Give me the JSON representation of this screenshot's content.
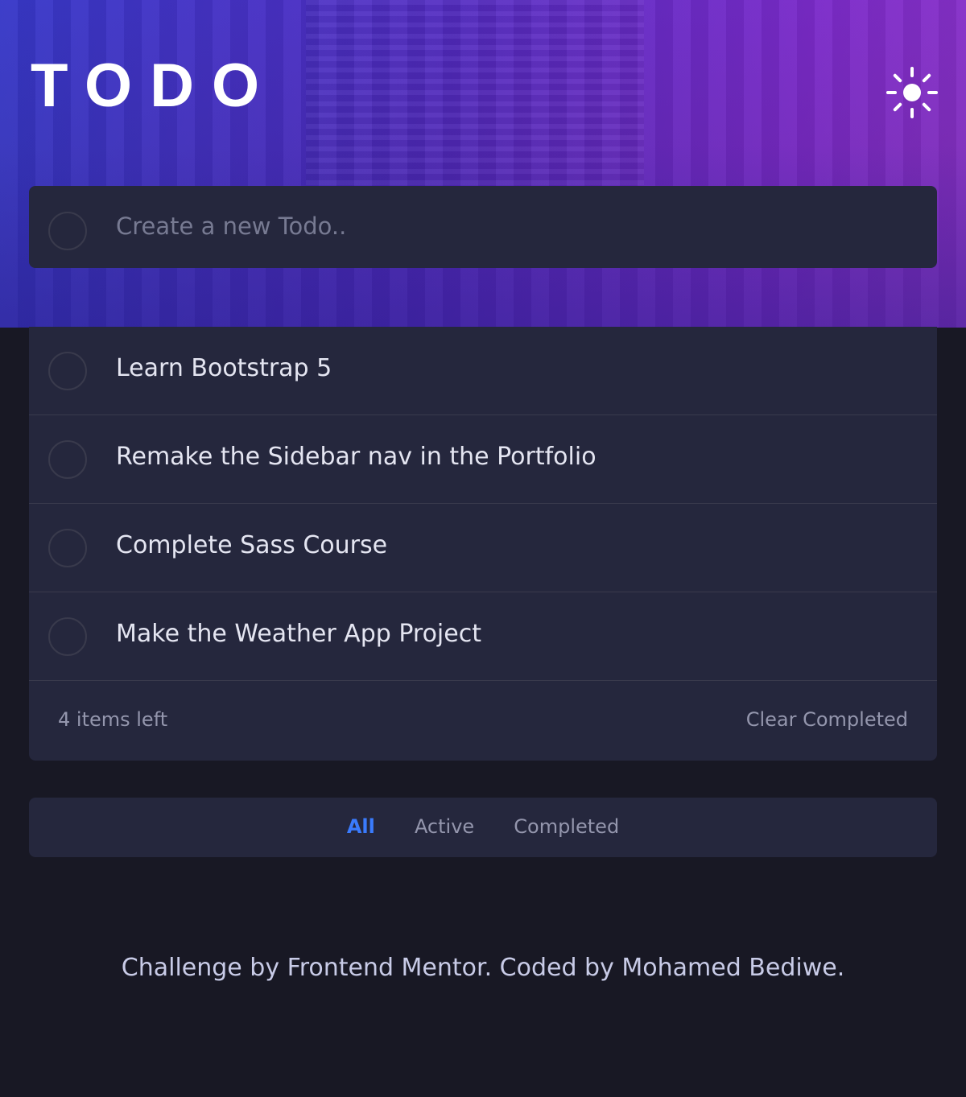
{
  "header": {
    "title": "TODO",
    "theme_toggle_icon": "sun-icon"
  },
  "new_todo": {
    "placeholder": "Create a new Todo.."
  },
  "todos": [
    {
      "text": "Learn Bootstrap 5"
    },
    {
      "text": "Remake the Sidebar nav in the Portfolio"
    },
    {
      "text": "Complete Sass Course"
    },
    {
      "text": "Make the Weather App Project"
    }
  ],
  "footer": {
    "items_left": "4 items left",
    "clear_completed": "Clear Completed"
  },
  "filters": {
    "all": "All",
    "active": "Active",
    "completed": "Completed",
    "selected": "All"
  },
  "attribution": "Challenge by Frontend Mentor. Coded by Mohamed Bediwe.",
  "colors": {
    "background": "#181824",
    "card": "#25273d",
    "accent": "#3a7bfd",
    "text": "#e4e5f1",
    "muted": "#9496ad"
  }
}
